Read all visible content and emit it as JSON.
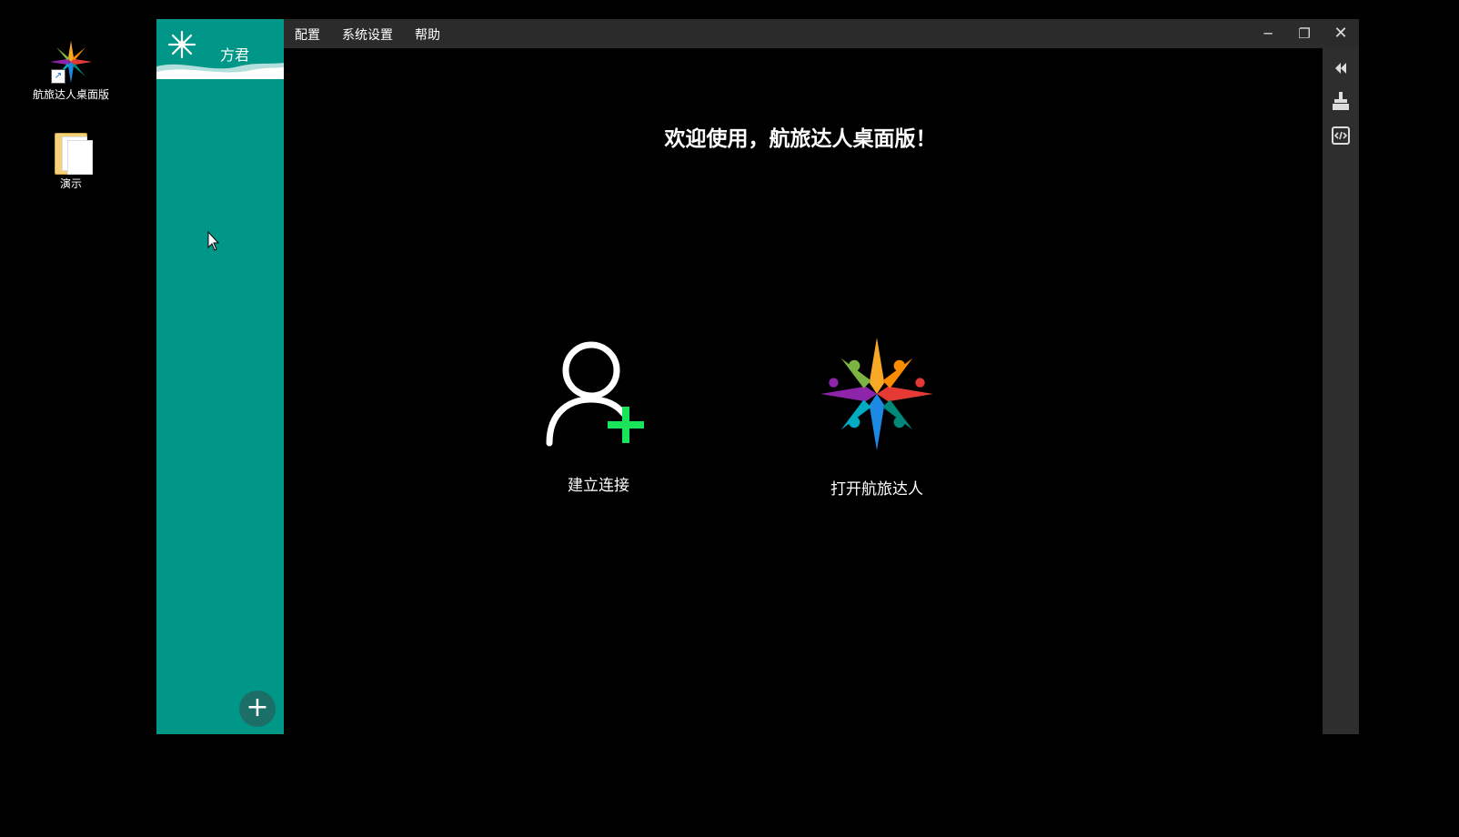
{
  "desktop": {
    "icons": [
      {
        "label": "航旅达人桌面版",
        "icon": "app-logo-icon"
      },
      {
        "label": "演示",
        "icon": "folder-icon"
      }
    ]
  },
  "sidebar": {
    "user_name": "方君",
    "add_button": "+"
  },
  "menu": {
    "config": "配置",
    "settings": "系统设置",
    "help": "帮助"
  },
  "window_controls": {
    "minimize": "─",
    "maximize": "❐",
    "close": "✕"
  },
  "main": {
    "welcome": "欢迎使用，航旅达人桌面版！",
    "actions": [
      {
        "label": "建立连接",
        "icon": "add-user-icon"
      },
      {
        "label": "打开航旅达人",
        "icon": "app-logo-icon"
      }
    ]
  },
  "right_toolbar": {
    "icons": [
      "collapse-left-icon",
      "clean-brush-icon",
      "code-icon"
    ]
  },
  "colors": {
    "sidebar": "#009688",
    "accent_green": "#19e35a",
    "titlebar": "#2b2b2b"
  }
}
